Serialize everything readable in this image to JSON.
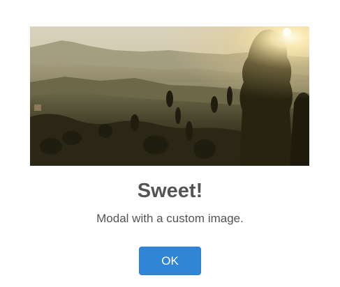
{
  "modal": {
    "title": "Sweet!",
    "text": "Modal with a custom image.",
    "confirm_label": "OK",
    "image_icon": "landscape-image"
  },
  "colors": {
    "confirm_button": "#3085d6",
    "title_text": "#545454",
    "body_text": "#545454",
    "background": "#ffffff"
  }
}
